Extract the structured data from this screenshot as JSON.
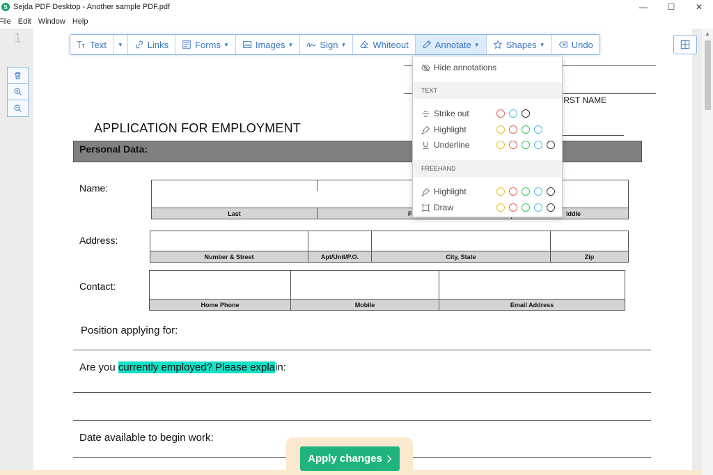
{
  "window": {
    "title": "Sejda PDF Desktop - Another sample PDF.pdf",
    "logo_letter": "S",
    "minimize": "—",
    "maximize": "☐",
    "close": "✕"
  },
  "menu": [
    "File",
    "Edit",
    "Window",
    "Help"
  ],
  "page_number": "1",
  "toolbar": {
    "text": "Text",
    "links": "Links",
    "forms": "Forms",
    "images": "Images",
    "sign": "Sign",
    "whiteout": "Whiteout",
    "annotate": "Annotate",
    "shapes": "Shapes",
    "undo": "Undo"
  },
  "annotate_menu": {
    "hide": "Hide annotations",
    "text_section": "TEXT",
    "strike_out": "Strike out",
    "highlight": "Highlight",
    "underline": "Underline",
    "freehand_section": "FREEHAND",
    "freehand_highlight": "Highlight",
    "draw": "Draw",
    "colors": {
      "red": "#e05c5c",
      "blue": "#4cbfe0",
      "black": "#333333",
      "yellow": "#e2c21c",
      "green": "#3dbf4f"
    }
  },
  "form": {
    "title": "APPLICATION FOR EMPLOYMENT",
    "first_name_fragment": "IRST NAME",
    "section": "Personal Data:",
    "name_label": "Name:",
    "name_last": "Last",
    "name_first": "Fi",
    "name_middle": "iddle",
    "address_label": "Address:",
    "addr_street": "Number & Street",
    "addr_apt": "Apt/Unit/P.O.",
    "addr_city": "City, State",
    "addr_zip": "Zip",
    "contact_label": "Contact:",
    "contact_home": "Home Phone",
    "contact_mobile": "Mobile",
    "contact_email": "Email Address",
    "position": "Position applying for:",
    "employed_pre": "Are you ",
    "employed_highlight": "currently employed?  Please expla",
    "employed_post": "in:",
    "date_available": "Date available to begin work:"
  },
  "apply": "Apply changes"
}
